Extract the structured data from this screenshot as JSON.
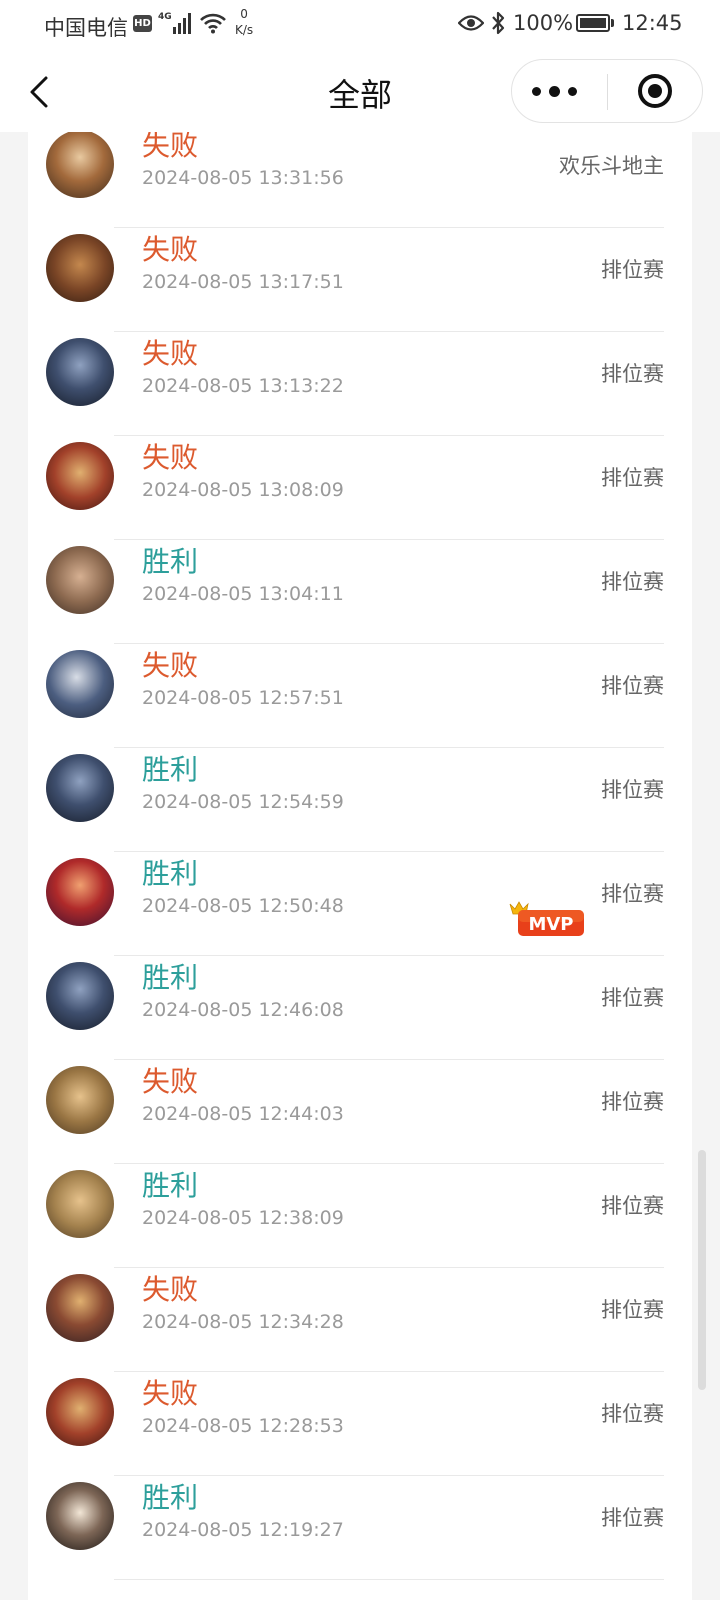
{
  "status_bar": {
    "carrier": "中国电信",
    "hd": "HD",
    "net_type": "4G",
    "speed_value": "0",
    "speed_unit": "K/s",
    "battery": "100%",
    "time": "12:45"
  },
  "nav": {
    "title": "全部"
  },
  "records": [
    {
      "result": "失败",
      "outcome": "lose",
      "time": "2024-08-05 13:31:56",
      "mode": "欢乐斗地主",
      "mvp": false
    },
    {
      "result": "失败",
      "outcome": "lose",
      "time": "2024-08-05 13:17:51",
      "mode": "排位赛",
      "mvp": false
    },
    {
      "result": "失败",
      "outcome": "lose",
      "time": "2024-08-05 13:13:22",
      "mode": "排位赛",
      "mvp": false
    },
    {
      "result": "失败",
      "outcome": "lose",
      "time": "2024-08-05 13:08:09",
      "mode": "排位赛",
      "mvp": false
    },
    {
      "result": "胜利",
      "outcome": "win",
      "time": "2024-08-05 13:04:11",
      "mode": "排位赛",
      "mvp": false
    },
    {
      "result": "失败",
      "outcome": "lose",
      "time": "2024-08-05 12:57:51",
      "mode": "排位赛",
      "mvp": false
    },
    {
      "result": "胜利",
      "outcome": "win",
      "time": "2024-08-05 12:54:59",
      "mode": "排位赛",
      "mvp": false
    },
    {
      "result": "胜利",
      "outcome": "win",
      "time": "2024-08-05 12:50:48",
      "mode": "排位赛",
      "mvp": true
    },
    {
      "result": "胜利",
      "outcome": "win",
      "time": "2024-08-05 12:46:08",
      "mode": "排位赛",
      "mvp": false
    },
    {
      "result": "失败",
      "outcome": "lose",
      "time": "2024-08-05 12:44:03",
      "mode": "排位赛",
      "mvp": false
    },
    {
      "result": "胜利",
      "outcome": "win",
      "time": "2024-08-05 12:38:09",
      "mode": "排位赛",
      "mvp": false
    },
    {
      "result": "失败",
      "outcome": "lose",
      "time": "2024-08-05 12:34:28",
      "mode": "排位赛",
      "mvp": false
    },
    {
      "result": "失败",
      "outcome": "lose",
      "time": "2024-08-05 12:28:53",
      "mode": "排位赛",
      "mvp": false
    },
    {
      "result": "胜利",
      "outcome": "win",
      "time": "2024-08-05 12:19:27",
      "mode": "排位赛",
      "mvp": false
    }
  ],
  "mvp_badge": "MVP",
  "colors": {
    "lose": "#dc5a2e",
    "win": "#2d9f9b"
  }
}
